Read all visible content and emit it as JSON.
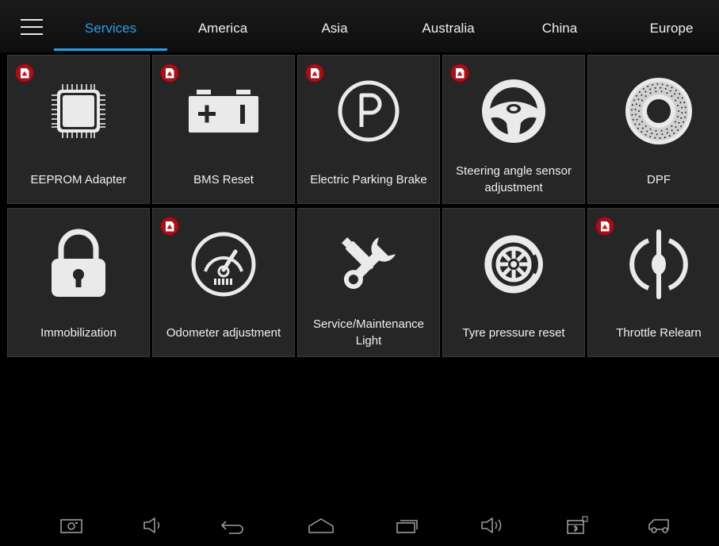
{
  "header": {
    "menu_icon": "hamburger-menu-icon",
    "tabs": [
      {
        "label": "Services",
        "active": true
      },
      {
        "label": "America",
        "active": false
      },
      {
        "label": "Asia",
        "active": false
      },
      {
        "label": "Australia",
        "active": false
      },
      {
        "label": "China",
        "active": false
      },
      {
        "label": "Europe",
        "active": false
      }
    ]
  },
  "colors": {
    "accent": "#2a9de6",
    "tile_bg": "#262626",
    "badge_red": "#a3121a",
    "text": "#f0f0f0"
  },
  "services": [
    {
      "label": "EEPROM Adapter",
      "icon": "chip-icon",
      "has_pdf": true
    },
    {
      "label": "BMS Reset",
      "icon": "battery-icon",
      "has_pdf": true
    },
    {
      "label": "Electric Parking Brake",
      "icon": "parking-brake-icon",
      "has_pdf": true
    },
    {
      "label": "Steering angle sensor adjustment",
      "icon": "steering-wheel-icon",
      "has_pdf": true
    },
    {
      "label": "DPF",
      "icon": "dpf-filter-icon",
      "has_pdf": false
    },
    {
      "label": "Immobilization",
      "icon": "padlock-icon",
      "has_pdf": false
    },
    {
      "label": "Odometer adjustment",
      "icon": "odometer-icon",
      "has_pdf": true
    },
    {
      "label": "Service/Maintenance Light",
      "icon": "wrench-screwdriver-icon",
      "has_pdf": false
    },
    {
      "label": "Tyre pressure reset",
      "icon": "tyre-icon",
      "has_pdf": false
    },
    {
      "label": "Throttle Relearn",
      "icon": "throttle-icon",
      "has_pdf": true
    }
  ],
  "navbar": [
    "screenshot-icon",
    "volume-down-icon",
    "back-icon",
    "home-icon",
    "recent-apps-icon",
    "volume-up-icon",
    "vci-connection-icon",
    "car-icon"
  ]
}
